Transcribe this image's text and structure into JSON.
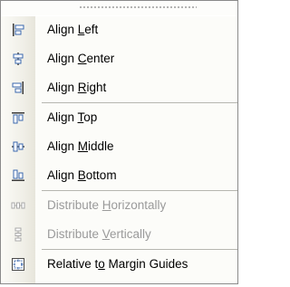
{
  "menu": {
    "items": [
      {
        "label": "Align Left",
        "accel": "L",
        "icon": "align-left-icon",
        "enabled": true
      },
      {
        "label": "Align Center",
        "accel": "C",
        "icon": "align-center-icon",
        "enabled": true
      },
      {
        "label": "Align Right",
        "accel": "R",
        "icon": "align-right-icon",
        "enabled": true
      },
      {
        "label": "Align Top",
        "accel": "T",
        "icon": "align-top-icon",
        "enabled": true
      },
      {
        "label": "Align Middle",
        "accel": "M",
        "icon": "align-middle-icon",
        "enabled": true
      },
      {
        "label": "Align Bottom",
        "accel": "B",
        "icon": "align-bottom-icon",
        "enabled": true
      },
      {
        "label": "Distribute Horizontally",
        "accel": "H",
        "icon": "distribute-horizontally-icon",
        "enabled": false
      },
      {
        "label": "Distribute Vertically",
        "accel": "V",
        "icon": "distribute-vertically-icon",
        "enabled": false
      },
      {
        "label": "Relative to Margin Guides",
        "accel": "o",
        "icon": "margin-guides-icon",
        "enabled": true
      }
    ],
    "colors": {
      "icon_blue": "#2f5fa8",
      "icon_dark": "#3b3b3b",
      "disabled_text": "#9a9a9a",
      "border": "#8a8a8a"
    }
  }
}
